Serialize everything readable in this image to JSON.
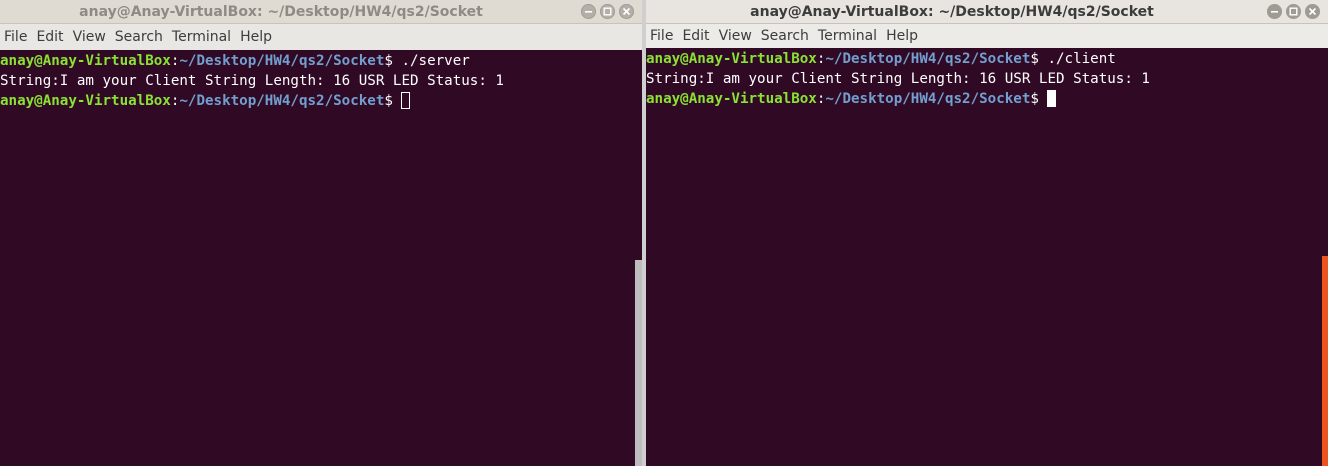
{
  "server_window": {
    "title": "anay@Anay-VirtualBox: ~/Desktop/HW4/qs2/Socket",
    "menu": [
      "File",
      "Edit",
      "View",
      "Search",
      "Terminal",
      "Help"
    ],
    "lines": [
      {
        "user": "anay@Anay-VirtualBox",
        "sep": ":",
        "path": "~/Desktop/HW4/qs2/Socket",
        "cmd": "$ ./server"
      },
      {
        "text": "String:I am your Client String Length: 16 USR LED Status: 1"
      },
      {
        "user": "anay@Anay-VirtualBox",
        "sep": ":",
        "path": "~/Desktop/HW4/qs2/Socket",
        "cmd": "$ "
      }
    ],
    "focused": false
  },
  "client_window": {
    "title": "anay@Anay-VirtualBox: ~/Desktop/HW4/qs2/Socket",
    "menu": [
      "File",
      "Edit",
      "View",
      "Search",
      "Terminal",
      "Help"
    ],
    "lines": [
      {
        "user": "anay@Anay-VirtualBox",
        "sep": ":",
        "path": "~/Desktop/HW4/qs2/Socket",
        "cmd": "$ ./client"
      },
      {
        "text": "String:I am your Client String Length: 16 USR LED Status: 1"
      },
      {
        "user": "anay@Anay-VirtualBox",
        "sep": ":",
        "path": "~/Desktop/HW4/qs2/Socket",
        "cmd": "$ "
      }
    ],
    "focused": true
  },
  "window_buttons": {
    "minimize": "minimize-icon",
    "maximize": "maximize-icon",
    "close": "close-icon"
  },
  "colors": {
    "terminal_bg": "#300a24",
    "prompt_user": "#8ae234",
    "prompt_path": "#729fcf",
    "scrollbar_active": "#e95420"
  }
}
